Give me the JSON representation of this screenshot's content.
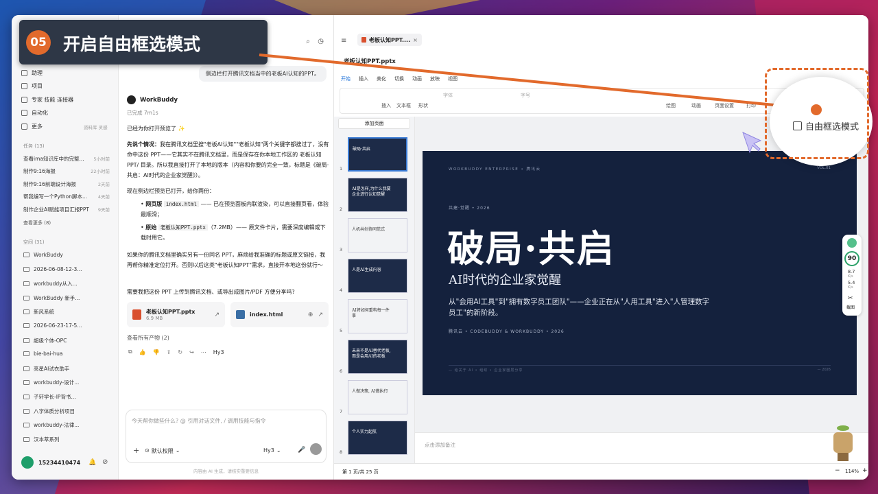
{
  "step": {
    "number": "05",
    "title": "开启自由框选模式"
  },
  "sidebar": {
    "items": [
      {
        "label": "助理"
      },
      {
        "label": "项目"
      },
      {
        "label": "专家 技能 连接器"
      },
      {
        "label": "自动化"
      },
      {
        "label": "更多",
        "extra": "资料库 灵感"
      }
    ],
    "tasks_header": "任务 (13)",
    "tasks": [
      {
        "title": "查看ima知识库中的完整...",
        "time": "5小时前"
      },
      {
        "title": "制作9:16海报",
        "time": "22小时前"
      },
      {
        "title": "制作9:16前端设计海报",
        "time": "2天前"
      },
      {
        "title": "帮我编写一个Python脚本...",
        "time": "4天前"
      },
      {
        "title": "制作企业AI赋能项目汇报PPT",
        "time": "9天前"
      }
    ],
    "tasks_more": "查看更多 (8)",
    "space_header": "空间 (31)",
    "projects": [
      "WorkBuddy",
      "2026-06-08-12-3...",
      "workbuddy从入...",
      "WorkBuddy 新手...",
      "新风系统",
      "2026-06-23-17-5...",
      "超级个体-OPC",
      "bie-bai-hua",
      "亮星AI试衣助手",
      "workbuddy-设计...",
      "子轩学长-IP背书...",
      "八字体质分析项目",
      "workbuddy-法律...",
      "汉本萃系列"
    ],
    "user": "15234410474"
  },
  "chat": {
    "user_message": "侧边栏打开腾讯文档当中的老板AI认知的PPT。",
    "agent_name": "WorkBuddy",
    "status": "已完成 7m1s",
    "line1": "已经为你打开预览了 ✨",
    "bold1": "先说个情况：",
    "para1": "我在腾讯文档里搜\"老板AI认知\"\"老板认知\"两个关键字都搜过了，没有命中这份 PPT——它其实不在腾讯文档里，而是保存在你本地工作区的 老板认知PPT/ 目录。所以我直接打开了本地的版本（内容和你要的完全一致，标题是《破局·共启：AI时代的企业家觉醒》）。",
    "para2": "现在侧边栏预览已打开，给你两份：",
    "b1_label": "网页版",
    "b1_code": "index.html",
    "b1_text": "—— 已在预览面板内联渲染，可以直接翻页看，体验最顺滑；",
    "b2_label": "原始",
    "b2_code": "老板认知PPT.pptx",
    "b2_text": "（7.2MB）—— 原文件卡片，需要深度编辑或下载时用它。",
    "para3": "如果你的腾讯文档里确实另有一份同名 PPT，麻烦给我准确的标题或原文链接，我再帮你精准定位打开。否则以后这类\"老板认知PPT\"需求，直接开本地这份就行～",
    "para4": "需要我把这份 PPT 上传到腾讯文档、或导出成图片/PDF 方便分享吗?",
    "file1_name": "老板认知PPT.pptx",
    "file1_size": "6.9 MB",
    "file2_name": "index.html",
    "all_outputs": "查看所有产物 (2)",
    "model_tag": "Hy3",
    "input_placeholder": "今天帮你做些什么? @ 引用对话文件, / 调用技能与指令",
    "permission": "默认权限",
    "model_select": "Hy3",
    "footer_note": "内容由 AI 生成，请核实重要信息"
  },
  "preview": {
    "tab_title": "老板认知PPT....",
    "file_title": "老板认知PPT.pptx",
    "ribbon_tabs": [
      "开始",
      "插入",
      "美化",
      "切换",
      "动画",
      "放映",
      "视图"
    ],
    "font_name": "字体",
    "font_size": "字号",
    "tools": [
      "插入",
      "文本框",
      "形状"
    ],
    "right_tools": [
      "绘图",
      "动画",
      "页面设置",
      "打印"
    ],
    "add_page": "添加页面",
    "thumb_titles": [
      "破局·共启",
      "AI是怎样,为什么我要企业进行认知觉醒",
      "人机共创协同范式",
      "人是AI生成内容",
      "AI将如何重构每一件事",
      "未来不是AI替代老板,而是会用AI的老板",
      "人做决策, AI做执行",
      "个人实力起航"
    ],
    "notes_placeholder": "点击添加备注",
    "page_indicator": "第 1 页/共 25 页",
    "zoom": "114%"
  },
  "slide": {
    "top_left": "WORKBUDDY ENTERPRISE  •  腾讯云",
    "top_right": "VOL.01",
    "kicker": "共建·觉醒  •  2026",
    "title": "破局·共启",
    "subtitle": "AI时代的企业家觉醒",
    "desc": "从\"会用AI工具\"到\"拥有数字员工团队\"——企业正在从\"人用工具\"进入\"人管理数字员工\"的新阶段。",
    "byline": "腾讯云  •  CODEBUDDY & WORKBUDDY  •  2026",
    "footer_left": "— 给关于 AI  •  组织  •  企业家圈层分享",
    "footer_right": "— 2026"
  },
  "callout": {
    "label": "自由框选模式"
  },
  "score": {
    "value": "90",
    "up": "8.7",
    "down": "5.4",
    "unit": "K/s",
    "shot": "截图"
  },
  "colors": {
    "accent": "#e26a2c",
    "slide_bg": "#14213d",
    "panel": "#2e3746"
  }
}
